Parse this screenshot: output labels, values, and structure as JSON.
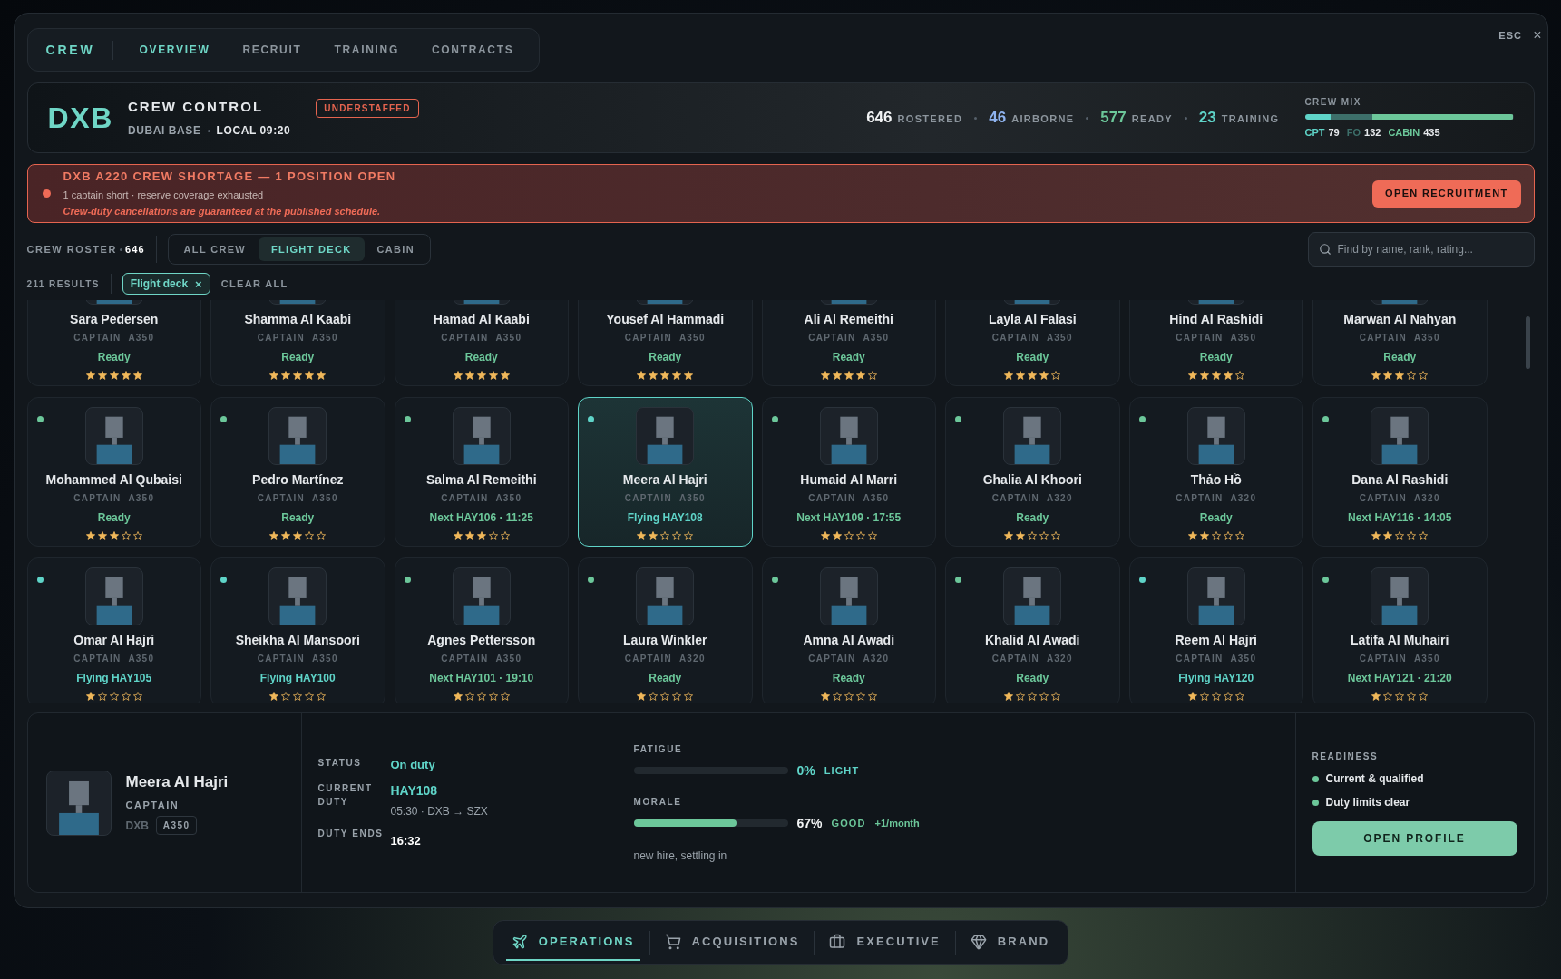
{
  "top_tabs": {
    "title": "CREW",
    "items": [
      {
        "label": "OVERVIEW",
        "selected": true
      },
      {
        "label": "RECRUIT",
        "selected": false
      },
      {
        "label": "TRAINING",
        "selected": false
      },
      {
        "label": "CONTRACTS",
        "selected": false
      }
    ]
  },
  "close": {
    "label": "ESC",
    "icon": "×"
  },
  "header": {
    "code": "DXB",
    "title": "CREW CONTROL",
    "base": "DUBAI BASE",
    "local": "LOCAL 09:20",
    "badge": "UNDERSTAFFED",
    "stats": [
      {
        "value": "646",
        "label": "ROSTERED",
        "color": "#f2f4f5"
      },
      {
        "value": "46",
        "label": "AIRBORNE",
        "color": "#8fb4f0"
      },
      {
        "value": "577",
        "label": "READY",
        "color": "#6cc79a"
      },
      {
        "value": "23",
        "label": "TRAINING",
        "color": "#5fd4c8"
      }
    ],
    "mix": {
      "title": "CREW MIX",
      "segments": [
        {
          "label": "CPT",
          "value": "79",
          "level": 0.122,
          "color": "#5fd4c8"
        },
        {
          "label": "FO",
          "value": "132",
          "level": 0.204,
          "color": "#3d6f6a"
        },
        {
          "label": "CABIN",
          "value": "435",
          "level": 0.674,
          "color": "#6cc79a"
        }
      ]
    }
  },
  "alert": {
    "title": "DXB A220 CREW SHORTAGE — 1 POSITION OPEN",
    "detail": "1 captain short · reserve coverage exhausted",
    "warning": "Crew-duty cancellations are guaranteed at the published schedule.",
    "action": "OPEN RECRUITMENT"
  },
  "roster": {
    "label": "CREW ROSTER",
    "count": "646",
    "filters": [
      {
        "label": "ALL CREW",
        "selected": false
      },
      {
        "label": "FLIGHT DECK",
        "selected": true
      },
      {
        "label": "CABIN",
        "selected": false
      }
    ],
    "search": {
      "placeholder": "Find by name, rank, rating..."
    },
    "results": "211 RESULTS",
    "chips": [
      {
        "label": "Flight deck",
        "remove": "×"
      }
    ],
    "clear": "CLEAR ALL"
  },
  "cards": [
    {
      "name": "Sara Pedersen",
      "rank": "CAPTAIN",
      "type": "A350",
      "status": "Ready",
      "kind": "ready",
      "stars": 5,
      "selected": false
    },
    {
      "name": "Shamma Al Kaabi",
      "rank": "CAPTAIN",
      "type": "A350",
      "status": "Ready",
      "kind": "ready",
      "stars": 5,
      "selected": false
    },
    {
      "name": "Hamad Al Kaabi",
      "rank": "CAPTAIN",
      "type": "A350",
      "status": "Ready",
      "kind": "ready",
      "stars": 5,
      "selected": false
    },
    {
      "name": "Yousef Al Hammadi",
      "rank": "CAPTAIN",
      "type": "A350",
      "status": "Ready",
      "kind": "ready",
      "stars": 5,
      "selected": false
    },
    {
      "name": "Ali Al Remeithi",
      "rank": "CAPTAIN",
      "type": "A350",
      "status": "Ready",
      "kind": "ready",
      "stars": 4,
      "selected": false
    },
    {
      "name": "Layla Al Falasi",
      "rank": "CAPTAIN",
      "type": "A350",
      "status": "Ready",
      "kind": "ready",
      "stars": 4,
      "selected": false
    },
    {
      "name": "Hind Al Rashidi",
      "rank": "CAPTAIN",
      "type": "A350",
      "status": "Ready",
      "kind": "ready",
      "stars": 4,
      "selected": false
    },
    {
      "name": "Marwan Al Nahyan",
      "rank": "CAPTAIN",
      "type": "A350",
      "status": "Ready",
      "kind": "ready",
      "stars": 3,
      "selected": false
    },
    {
      "name": "Mohammed Al Qubaisi",
      "rank": "CAPTAIN",
      "type": "A350",
      "status": "Ready",
      "kind": "ready",
      "stars": 3,
      "color": "#6cc79a",
      "selected": false
    },
    {
      "name": "Pedro Martínez",
      "rank": "CAPTAIN",
      "type": "A350",
      "status": "Ready",
      "kind": "ready",
      "stars": 3,
      "color": "#6cc79a",
      "selected": false
    },
    {
      "name": "Salma Al Remeithi",
      "rank": "CAPTAIN",
      "type": "A350",
      "status": "Next HAY106 · 11:25",
      "kind": "next",
      "stars": 3,
      "color": "#6cc79a",
      "selected": false
    },
    {
      "name": "Meera Al Hajri",
      "rank": "CAPTAIN",
      "type": "A350",
      "status": "Flying HAY108",
      "kind": "flying",
      "stars": 2,
      "color": "#5fd4c8",
      "selected": true
    },
    {
      "name": "Humaid Al Marri",
      "rank": "CAPTAIN",
      "type": "A350",
      "status": "Next HAY109 · 17:55",
      "kind": "next",
      "stars": 2,
      "color": "#6cc79a",
      "selected": false
    },
    {
      "name": "Ghalia Al Khoori",
      "rank": "CAPTAIN",
      "type": "A320",
      "status": "Ready",
      "kind": "ready",
      "stars": 2,
      "color": "#6cc79a",
      "selected": false
    },
    {
      "name": "Thảo Hồ",
      "rank": "CAPTAIN",
      "type": "A320",
      "status": "Ready",
      "kind": "ready",
      "stars": 2,
      "color": "#6cc79a",
      "selected": false
    },
    {
      "name": "Dana Al Rashidi",
      "rank": "CAPTAIN",
      "type": "A320",
      "status": "Next HAY116 · 14:05",
      "kind": "next",
      "stars": 2,
      "color": "#6cc79a",
      "selected": false
    },
    {
      "name": "Omar Al Hajri",
      "rank": "CAPTAIN",
      "type": "A350",
      "status": "Flying HAY105",
      "kind": "flying",
      "stars": 1,
      "color": "#5fd4c8",
      "selected": false
    },
    {
      "name": "Sheikha Al Mansoori",
      "rank": "CAPTAIN",
      "type": "A350",
      "status": "Flying HAY100",
      "kind": "flying",
      "stars": 1,
      "color": "#5fd4c8",
      "selected": false
    },
    {
      "name": "Agnes Pettersson",
      "rank": "CAPTAIN",
      "type": "A350",
      "status": "Next HAY101 · 19:10",
      "kind": "next",
      "stars": 1,
      "color": "#6cc79a",
      "selected": false
    },
    {
      "name": "Laura Winkler",
      "rank": "CAPTAIN",
      "type": "A320",
      "status": "Ready",
      "kind": "ready",
      "stars": 1,
      "color": "#6cc79a",
      "selected": false
    },
    {
      "name": "Amna Al Awadi",
      "rank": "CAPTAIN",
      "type": "A320",
      "status": "Ready",
      "kind": "ready",
      "stars": 1,
      "color": "#6cc79a",
      "selected": false
    },
    {
      "name": "Khalid Al Awadi",
      "rank": "CAPTAIN",
      "type": "A320",
      "status": "Ready",
      "kind": "ready",
      "stars": 1,
      "color": "#6cc79a",
      "selected": false
    },
    {
      "name": "Reem Al Hajri",
      "rank": "CAPTAIN",
      "type": "A350",
      "status": "Flying HAY120",
      "kind": "flying",
      "stars": 1,
      "color": "#5fd4c8",
      "selected": false
    },
    {
      "name": "Latifa Al Muhairi",
      "rank": "CAPTAIN",
      "type": "A350",
      "status": "Next HAY121 · 21:20",
      "kind": "next",
      "stars": 1,
      "color": "#6cc79a",
      "selected": false
    }
  ],
  "detail": {
    "name": "Meera Al Hajri",
    "rank": "CAPTAIN",
    "base": "DXB",
    "type": "A350",
    "fields": [
      {
        "label": "STATUS",
        "value": "On duty",
        "kind": "status"
      },
      {
        "label": "CURRENT DUTY",
        "value": "HAY108",
        "sub": "05:30 · DXB → SZX",
        "kind": "flight"
      },
      {
        "label": "DUTY ENDS",
        "value": "16:32",
        "kind": "plain"
      }
    ],
    "meters": [
      {
        "label": "FATIGUE",
        "kind": "fatigue",
        "level": 0,
        "value": "0%",
        "grade": "LIGHT"
      },
      {
        "label": "MORALE",
        "kind": "morale",
        "level": 0.67,
        "value": "67%",
        "grade": "GOOD",
        "trend": "+1/month"
      }
    ],
    "note": "new hire, settling in",
    "readiness": {
      "title": "READINESS",
      "items": [
        {
          "label": "Current & qualified",
          "color": "#6cc79a"
        },
        {
          "label": "Duty limits clear",
          "color": "#6cc79a"
        }
      ],
      "action": "OPEN PROFILE"
    }
  },
  "bottom_nav": [
    {
      "label": "OPERATIONS",
      "selected": true
    },
    {
      "label": "ACQUISITIONS",
      "selected": false
    },
    {
      "label": "EXECUTIVE",
      "selected": false
    },
    {
      "label": "BRAND",
      "selected": false
    }
  ]
}
